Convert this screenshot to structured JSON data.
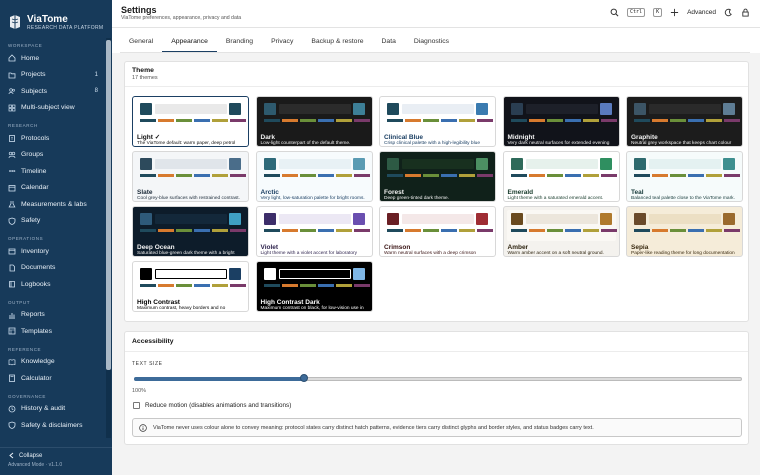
{
  "app": {
    "name": "ViaTome",
    "subtitle": "RESEARCH DATA PLATFORM"
  },
  "sidebar": {
    "sections": [
      {
        "label": "WORKSPACE",
        "items": [
          {
            "label": "Home",
            "icon": "home-icon"
          },
          {
            "label": "Projects",
            "icon": "folder-icon",
            "count": "1"
          },
          {
            "label": "Subjects",
            "icon": "users-icon",
            "count": "8"
          },
          {
            "label": "Multi-subject view",
            "icon": "grid-icon"
          }
        ]
      },
      {
        "label": "RESEARCH",
        "items": [
          {
            "label": "Protocols",
            "icon": "clipboard-icon"
          },
          {
            "label": "Groups",
            "icon": "group-icon"
          },
          {
            "label": "Timeline",
            "icon": "timeline-icon"
          },
          {
            "label": "Calendar",
            "icon": "calendar-icon"
          },
          {
            "label": "Measurements & labs",
            "icon": "flask-icon"
          },
          {
            "label": "Safety",
            "icon": "shield-icon"
          }
        ]
      },
      {
        "label": "OPERATIONS",
        "items": [
          {
            "label": "Inventory",
            "icon": "box-icon"
          },
          {
            "label": "Documents",
            "icon": "document-icon"
          },
          {
            "label": "Logbooks",
            "icon": "book-icon"
          }
        ]
      },
      {
        "label": "OUTPUT",
        "items": [
          {
            "label": "Reports",
            "icon": "chart-icon"
          },
          {
            "label": "Templates",
            "icon": "template-icon"
          }
        ]
      },
      {
        "label": "REFERENCE",
        "items": [
          {
            "label": "Knowledge",
            "icon": "book-open-icon"
          },
          {
            "label": "Calculator",
            "icon": "calculator-icon"
          }
        ]
      },
      {
        "label": "GOVERNANCE",
        "items": [
          {
            "label": "History & audit",
            "icon": "history-icon"
          },
          {
            "label": "Safety & disclaimers",
            "icon": "shield-icon"
          }
        ]
      }
    ],
    "collapse_label": "Collapse",
    "version": "Advanced Mode · v1.1.0"
  },
  "header": {
    "title": "Settings",
    "subtitle": "ViaTome preferences, appearance, privacy and data",
    "shortcut_keys": [
      "Ctrl",
      "K"
    ],
    "mode_label": "Advanced"
  },
  "tabs": [
    {
      "label": "General",
      "active": false
    },
    {
      "label": "Appearance",
      "active": true
    },
    {
      "label": "Branding",
      "active": false
    },
    {
      "label": "Privacy",
      "active": false
    },
    {
      "label": "Backup & restore",
      "active": false
    },
    {
      "label": "Data",
      "active": false
    },
    {
      "label": "Diagnostics",
      "active": false
    }
  ],
  "theme_section": {
    "title": "Theme",
    "count": "17 themes",
    "themes": [
      {
        "name": "Light ✓",
        "desc": "The ViaTome default: warm paper, deep petrol ink.",
        "bg": "#ffffff",
        "tile_bg": "#ffffff",
        "fg": "#111111",
        "box1": "#1f4a5c",
        "bar": "#e9e9e9",
        "box2": "#1f4a5c",
        "selected": true
      },
      {
        "name": "Dark",
        "desc": "Low-light counterpart of the default theme.",
        "bg": "#1a1a1a",
        "tile_bg": "#1a1a1a",
        "fg": "#f2f2f2",
        "box1": "#2e5a6e",
        "bar": "#2b2b2b",
        "box2": "#3d7f97",
        "selected": false
      },
      {
        "name": "Clinical Blue",
        "desc": "Crisp clinical palette with a high-legibility blue accent.",
        "bg": "#ffffff",
        "tile_bg": "#ffffff",
        "fg": "#1b3f63",
        "box1": "#1f4a5c",
        "bar": "#e9eef4",
        "box2": "#3a7bb0",
        "selected": false
      },
      {
        "name": "Midnight",
        "desc": "Very dark neutral surfaces for extended evening sessions.",
        "bg": "#11131a",
        "tile_bg": "#11131a",
        "fg": "#f2f2f2",
        "box1": "#2a3e52",
        "bar": "#1d2029",
        "box2": "#5a7bbf",
        "selected": false
      },
      {
        "name": "Graphite",
        "desc": "Neutral grey workspace that keeps chart colour dominant.",
        "bg": "#1c1c1c",
        "tile_bg": "#1c1c1c",
        "fg": "#f2f2f2",
        "box1": "#3c5566",
        "bar": "#2a2a2a",
        "box2": "#5e7d95",
        "selected": false
      },
      {
        "name": "Slate",
        "desc": "Cool grey-blue surfaces with restrained contrast.",
        "bg": "#f4f6f8",
        "tile_bg": "#f4f6f8",
        "fg": "#1b2a38",
        "box1": "#2d4a5c",
        "bar": "#e0e5ea",
        "box2": "#4a6d8a",
        "selected": false
      },
      {
        "name": "Arctic",
        "desc": "Very light, low-saturation palette for bright rooms.",
        "bg": "#f7fbfd",
        "tile_bg": "#f7fbfd",
        "fg": "#1b3f63",
        "box1": "#2e6a7a",
        "bar": "#e8f1f5",
        "box2": "#5a9bb3",
        "selected": false
      },
      {
        "name": "Forest",
        "desc": "Deep green-tinted dark theme.",
        "bg": "#10211a",
        "tile_bg": "#10211a",
        "fg": "#f2f2f2",
        "box1": "#2d5a44",
        "bar": "#18301f",
        "box2": "#4c8f62",
        "selected": false
      },
      {
        "name": "Emerald",
        "desc": "Light theme with a saturated emerald accent.",
        "bg": "#ffffff",
        "tile_bg": "#ffffff",
        "fg": "#163a2a",
        "box1": "#2e6a5a",
        "bar": "#e6f1ec",
        "box2": "#2f8f60",
        "selected": false
      },
      {
        "name": "Teal",
        "desc": "Balanced teal palette close to the ViaTome mark.",
        "bg": "#f6fbfb",
        "tile_bg": "#f6fbfb",
        "fg": "#163a3a",
        "box1": "#2e6a6e",
        "bar": "#e4f1f1",
        "box2": "#3e8f8f",
        "selected": false
      },
      {
        "name": "Deep Ocean",
        "desc": "Saturated blue-green dark theme with a bright accent.",
        "bg": "#0d1c2a",
        "tile_bg": "#0d1c2a",
        "fg": "#f2f2f2",
        "box1": "#2e5a7a",
        "bar": "#13283a",
        "box2": "#3fa0c4",
        "selected": false
      },
      {
        "name": "Violet",
        "desc": "Light theme with a violet accent for laboratory dashboards.",
        "bg": "#ffffff",
        "tile_bg": "#ffffff",
        "fg": "#2a1f4a",
        "box1": "#3d2e6a",
        "bar": "#ece8f4",
        "box2": "#6a4fb0",
        "selected": false
      },
      {
        "name": "Crimson",
        "desc": "Warm neutral surfaces with a deep crimson accent.",
        "bg": "#ffffff",
        "tile_bg": "#ffffff",
        "fg": "#3a1414",
        "box1": "#6a1f24",
        "bar": "#f4e8e8",
        "box2": "#9f2d34",
        "selected": false
      },
      {
        "name": "Amber",
        "desc": "Warm amber accent on a soft neutral ground.",
        "bg": "#faf8f4",
        "tile_bg": "#f4f2ee",
        "fg": "#2e2410",
        "box1": "#6a4a1f",
        "bar": "#ece6dc",
        "box2": "#b07a2d",
        "selected": false
      },
      {
        "name": "Sepia",
        "desc": "Paper-like reading theme for long documentation sessions.",
        "bg": "#f5ecd9",
        "tile_bg": "#f5ecd9",
        "fg": "#3a2a10",
        "box1": "#6a4a2a",
        "bar": "#ecdfc4",
        "box2": "#9a6a2e",
        "selected": false
      },
      {
        "name": "High Contrast",
        "desc": "Maximum contrast, heavy borders and no decorative tints.",
        "bg": "#ffffff",
        "tile_bg": "#ffffff",
        "fg": "#000000",
        "box1": "#000000",
        "bar": "#ffffff",
        "box2": "#1b3f63",
        "selected": false
      },
      {
        "name": "High Contrast Dark",
        "desc": "Maximum contrast on black, for low-vision use in dark rooms.",
        "bg": "#000000",
        "tile_bg": "#000000",
        "fg": "#ffffff",
        "box1": "#ffffff",
        "bar": "#000000",
        "box2": "#7fb7e6",
        "selected": false
      }
    ],
    "stripe_colors": [
      "#1f4a5c",
      "#d77a2e",
      "#6a8f3a",
      "#3a6fb0",
      "#b0a03a",
      "#7a3a6a",
      "#2e7a6a"
    ]
  },
  "accessibility": {
    "title": "Accessibility",
    "text_size_label": "TEXT SIZE",
    "text_size_value": 0.28,
    "text_size_text": "100%",
    "reduce_motion_label": "Reduce motion (disables animations and transitions)",
    "reduce_motion_checked": false,
    "info": "ViaTome never uses colour alone to convey meaning: protocol states carry distinct hatch patterns, evidence tiers carry distinct glyphs and border styles, and status badges carry text."
  }
}
